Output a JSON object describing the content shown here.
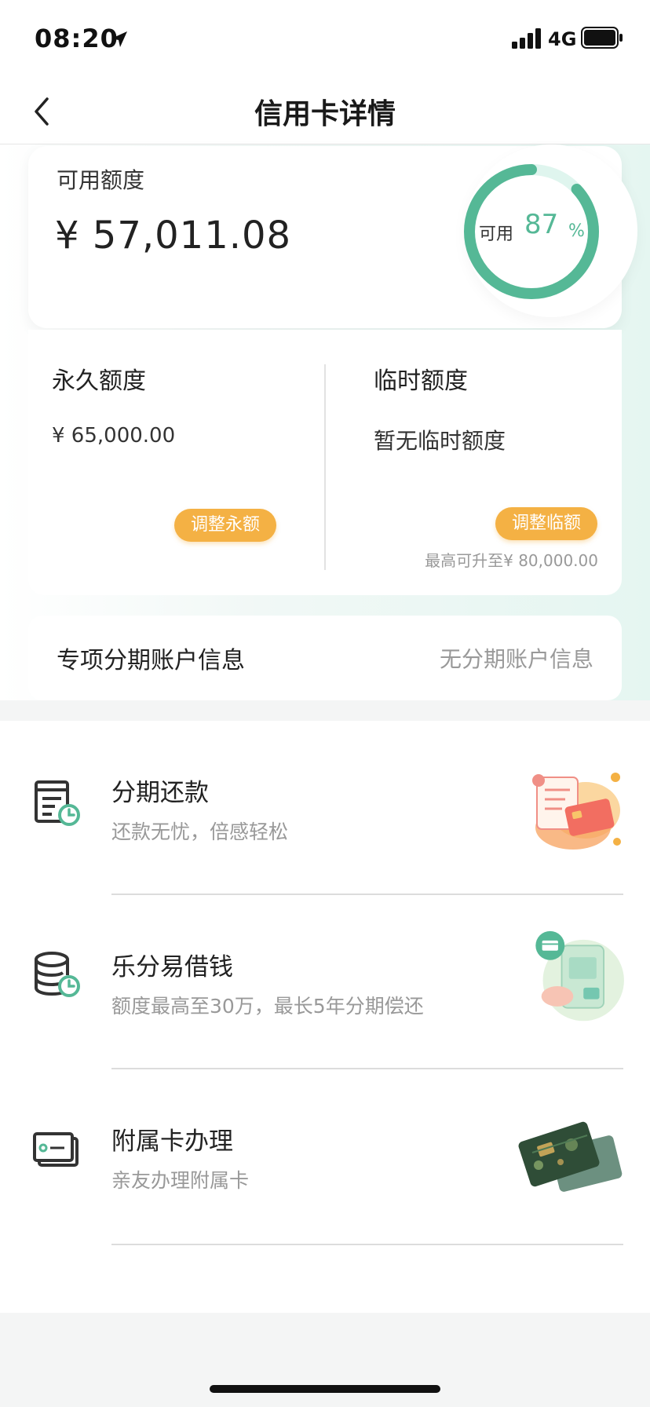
{
  "status_bar": {
    "time": "08:20",
    "network": "4G"
  },
  "nav": {
    "title": "信用卡详情"
  },
  "available": {
    "label": "可用额度",
    "amount": "¥ 57,011.08",
    "ring": {
      "label": "可用",
      "value": "87",
      "unit": "%",
      "percent": 87
    }
  },
  "limits": {
    "permanent": {
      "title": "永久额度",
      "value": "¥ 65,000.00",
      "button": "调整永额"
    },
    "temporary": {
      "title": "临时额度",
      "value": "暂无临时额度",
      "button": "调整临额",
      "note": "最高可升至¥ 80,000.00"
    }
  },
  "installment_account": {
    "title": "专项分期账户信息",
    "value": "无分期账户信息"
  },
  "services": [
    {
      "title": "分期还款",
      "desc": "还款无忧，倍感轻松",
      "icon": "bill-clock-icon"
    },
    {
      "title": "乐分易借钱",
      "desc": "额度最高至30万，最长5年分期偿还",
      "icon": "coins-clock-icon"
    },
    {
      "title": "附属卡办理",
      "desc": "亲友办理附属卡",
      "icon": "cards-icon"
    }
  ],
  "colors": {
    "accent_green": "#55b896",
    "button_orange": "#f4b144"
  }
}
